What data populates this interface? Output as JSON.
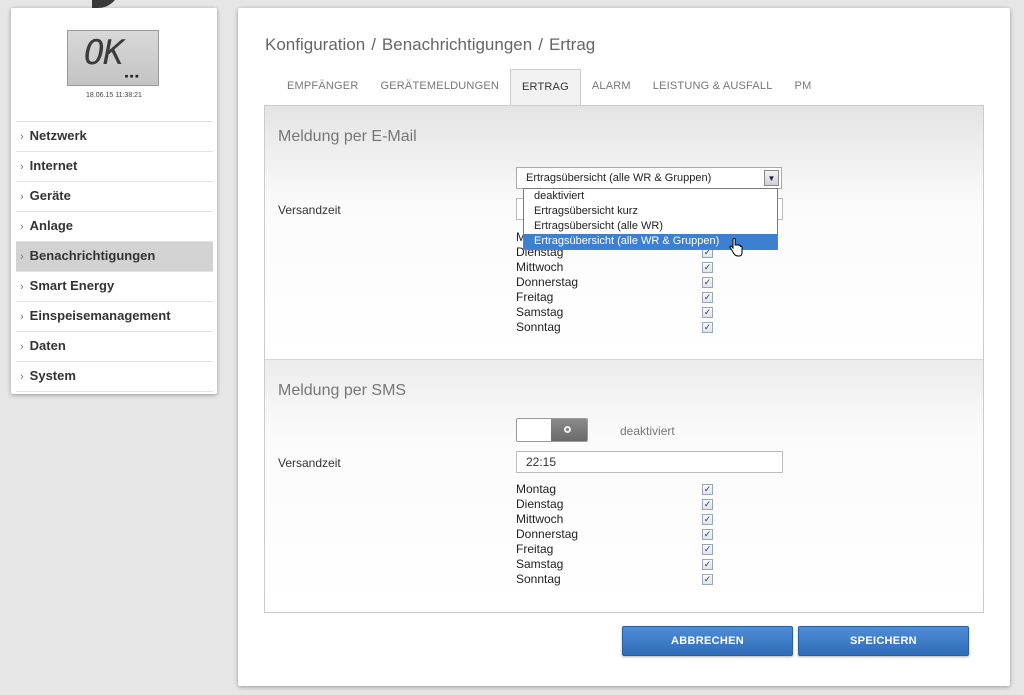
{
  "device": {
    "display_text": "OK",
    "display_dots": "▪▪▪",
    "timestamp": "18.06.15 11:38:21"
  },
  "sidebar": {
    "items": [
      {
        "label": "Netzwerk",
        "active": false
      },
      {
        "label": "Internet",
        "active": false
      },
      {
        "label": "Geräte",
        "active": false
      },
      {
        "label": "Anlage",
        "active": false
      },
      {
        "label": "Benachrichtigungen",
        "active": true
      },
      {
        "label": "Smart Energy",
        "active": false
      },
      {
        "label": "Einspeisemanagement",
        "active": false
      },
      {
        "label": "Daten",
        "active": false
      },
      {
        "label": "System",
        "active": false
      }
    ]
  },
  "breadcrumb": {
    "part1": "Konfiguration",
    "part2": "Benachrichtigungen",
    "part3": "Ertrag",
    "separator": "/"
  },
  "tabs": [
    {
      "label": "EMPFÄNGER",
      "active": false
    },
    {
      "label": "GERÄTEMELDUNGEN",
      "active": false
    },
    {
      "label": "ERTRAG",
      "active": true
    },
    {
      "label": "ALARM",
      "active": false
    },
    {
      "label": "LEISTUNG & AUSFALL",
      "active": false
    },
    {
      "label": "PM",
      "active": false
    }
  ],
  "email": {
    "title": "Meldung per E-Mail",
    "select_value": "Ertragsübersicht (alle WR & Gruppen)",
    "options": [
      "deaktiviert",
      "Ertragsübersicht kurz",
      "Ertragsübersicht (alle WR)",
      "Ertragsübersicht (alle WR & Gruppen)"
    ],
    "send_time_label": "Versandzeit",
    "days": [
      {
        "label": "M",
        "checked": true
      },
      {
        "label": "Dienstag",
        "checked": true
      },
      {
        "label": "Mittwoch",
        "checked": true
      },
      {
        "label": "Donnerstag",
        "checked": true
      },
      {
        "label": "Freitag",
        "checked": true
      },
      {
        "label": "Samstag",
        "checked": true
      },
      {
        "label": "Sonntag",
        "checked": true
      }
    ]
  },
  "sms": {
    "title": "Meldung per SMS",
    "toggle_state": "deaktiviert",
    "send_time_label": "Versandzeit",
    "send_time_value": "22:15",
    "days": [
      {
        "label": "Montag",
        "checked": true
      },
      {
        "label": "Dienstag",
        "checked": true
      },
      {
        "label": "Mittwoch",
        "checked": true
      },
      {
        "label": "Donnerstag",
        "checked": true
      },
      {
        "label": "Freitag",
        "checked": true
      },
      {
        "label": "Samstag",
        "checked": true
      },
      {
        "label": "Sonntag",
        "checked": true
      }
    ]
  },
  "buttons": {
    "cancel": "ABBRECHEN",
    "save": "SPEICHERN"
  },
  "colors": {
    "accent": "#3d7fd0",
    "button": "#2f6cb8"
  },
  "icons": {
    "check": "✓",
    "chevron": "›",
    "dropdown_arrow": "▼"
  }
}
